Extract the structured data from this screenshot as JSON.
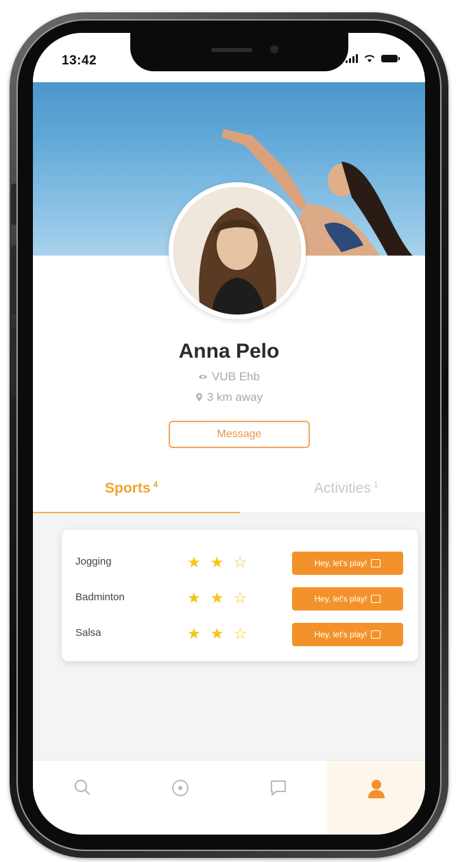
{
  "status_bar": {
    "time": "13:42"
  },
  "profile": {
    "name": "Anna Pelo",
    "affiliation": "VUB Ehb",
    "distance": "3 km away",
    "message_label": "Message"
  },
  "tabs": [
    {
      "label": "Sports",
      "count": "4",
      "active": true
    },
    {
      "label": "Activities",
      "count": "1",
      "active": false
    }
  ],
  "sports": [
    {
      "name": "Jogging",
      "rating": 2,
      "max_rating": 3,
      "action": "Hey, let's play!"
    },
    {
      "name": "Badminton",
      "rating": 2,
      "max_rating": 3,
      "action": "Hey, let's play!"
    },
    {
      "name": "Salsa",
      "rating": 2,
      "max_rating": 3,
      "action": "Hey, let's play!"
    }
  ],
  "bottom_nav": {
    "items": [
      {
        "icon": "search-icon",
        "active": false
      },
      {
        "icon": "compass-icon",
        "active": false
      },
      {
        "icon": "chat-icon",
        "active": false
      },
      {
        "icon": "user-icon",
        "active": true
      }
    ]
  },
  "colors": {
    "accent": "#f3922a",
    "tab_active": "#f1a52b",
    "star": "#f5c518"
  }
}
